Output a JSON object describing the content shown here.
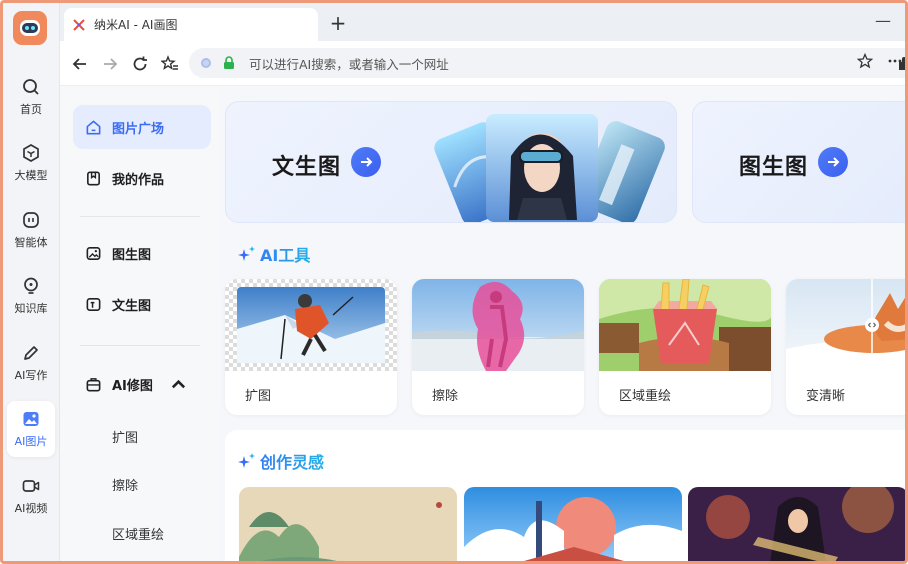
{
  "browser": {
    "tab_title": "纳米AI - AI画图",
    "new_tab": "+",
    "minimize": "—",
    "address_placeholder": "可以进行AI搜索，或者输入一个网址"
  },
  "rail": {
    "items": [
      {
        "label": "首页",
        "icon": "search-icon"
      },
      {
        "label": "大模型",
        "icon": "cube-icon"
      },
      {
        "label": "智能体",
        "icon": "agent-icon"
      },
      {
        "label": "知识库",
        "icon": "bulb-icon"
      },
      {
        "label": "AI写作",
        "icon": "pen-icon"
      },
      {
        "label": "AI图片",
        "icon": "image-icon"
      },
      {
        "label": "AI视频",
        "icon": "video-icon"
      }
    ]
  },
  "sidebar": {
    "plaza": "图片广场",
    "works": "我的作品",
    "img2img": "图生图",
    "txt2img": "文生图",
    "ai_edit": "AI修图",
    "sub_items": [
      "扩图",
      "擦除",
      "区域重绘"
    ]
  },
  "hero": {
    "card1": "文生图",
    "card2": "图生图"
  },
  "sections": {
    "tools": "AI工具",
    "inspiration": "创作灵感"
  },
  "tools": [
    "扩图",
    "擦除",
    "区域重绘",
    "变清晰"
  ],
  "colors": {
    "accent": "#3b6cf6",
    "frame": "#ee9a78",
    "logo": "#f08a5d"
  }
}
